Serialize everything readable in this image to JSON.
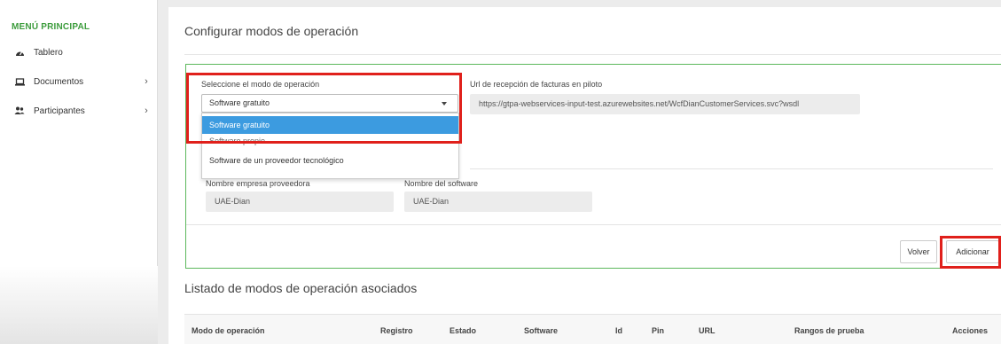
{
  "sidebar": {
    "title": "MENÚ PRINCIPAL",
    "items": [
      {
        "label": "Tablero",
        "icon": "dashboard-icon",
        "has_chevron": false
      },
      {
        "label": "Documentos",
        "icon": "laptop-icon",
        "has_chevron": true
      },
      {
        "label": "Participantes",
        "icon": "users-icon",
        "has_chevron": true
      }
    ]
  },
  "page": {
    "title": "Configurar modos de operación"
  },
  "form": {
    "mode_label": "Seleccione el modo de operación",
    "mode_selected": "Software gratuito",
    "mode_options": [
      "Software gratuito",
      "Software propio",
      "Software de un proveedor tecnológico"
    ],
    "url_label": "Url de recepción de facturas en piloto",
    "url_value": "https://gtpa-webservices-input-test.azurewebsites.net/WcfDianCustomerServices.svc?wsdl",
    "provider_label": "Nombre empresa proveedora",
    "provider_value": "UAE-Dian",
    "software_label": "Nombre del software",
    "software_value": "UAE-Dian"
  },
  "buttons": {
    "back": "Volver",
    "add": "Adicionar"
  },
  "list": {
    "title": "Listado de modos de operación asociados",
    "columns": [
      "Modo de operación",
      "Registro",
      "Estado",
      "Software",
      "Id",
      "Pin",
      "URL",
      "Rangos de prueba",
      "Acciones"
    ]
  },
  "colors": {
    "accent_green": "#3c9c3c",
    "form_border": "#5cb85c",
    "highlight_red": "#e0201b",
    "selected_blue": "#3c9be0"
  }
}
